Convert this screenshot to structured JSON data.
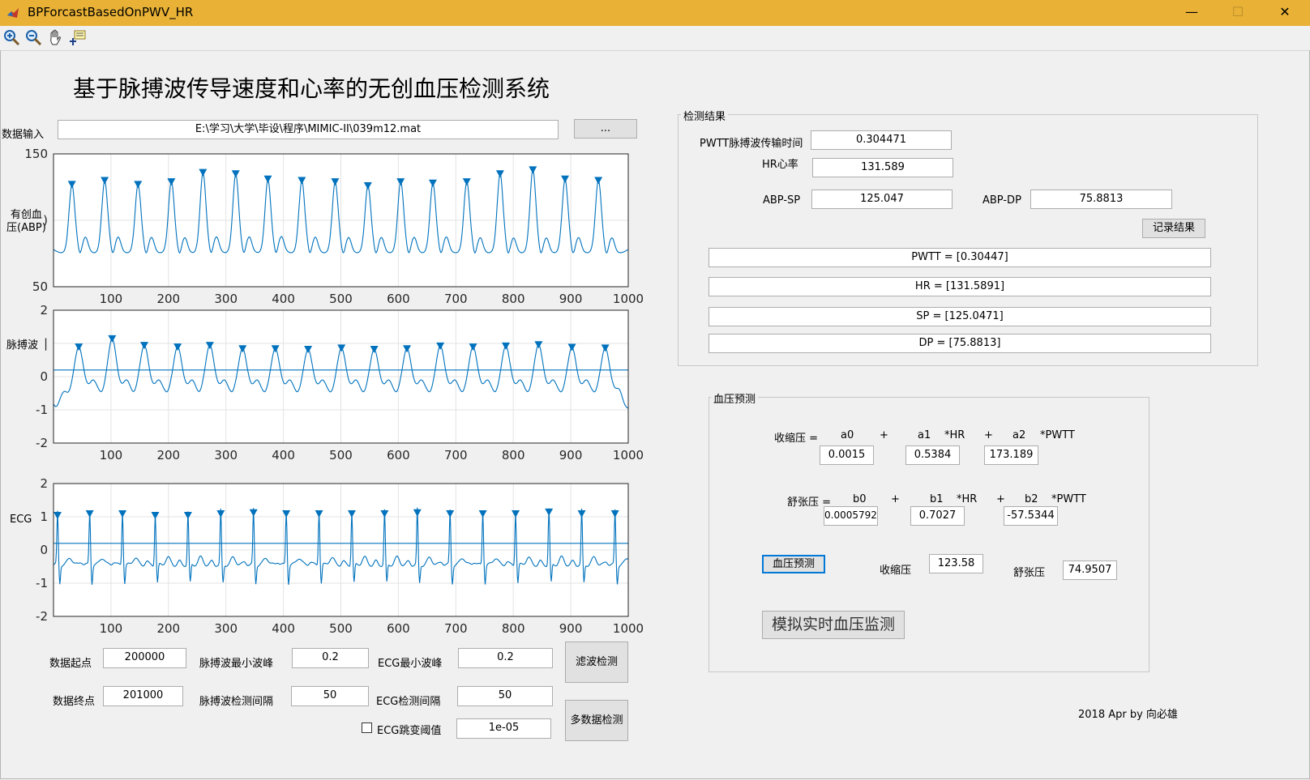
{
  "window": {
    "title": "BPForcastBasedOnPWV_HR",
    "minimize": "—",
    "maximize": "☐",
    "close": "✕"
  },
  "toolbar": {
    "icons": [
      "zoom-in-icon",
      "zoom-out-icon",
      "pan-icon",
      "data-cursor-icon"
    ]
  },
  "main_title": "基于脉搏波传导速度和心率的无创血压检测系统",
  "data_input": {
    "label": "数据输入",
    "path": "E:\\学习\\大学\\毕设\\程序\\MIMIC-II\\039m12.mat",
    "browse_label": "..."
  },
  "plots": {
    "abp": {
      "ylabel": "有创血压(ABP)",
      "ylabel_l1": "有创血",
      "ylabel_l2": "压(ABP)"
    },
    "ppg": {
      "ylabel": "脉搏波"
    },
    "ecg": {
      "ylabel": "ECG"
    }
  },
  "chart_data": [
    {
      "type": "line",
      "name": "abp",
      "xlim": [
        0,
        1000
      ],
      "ylim": [
        50,
        150
      ],
      "xticks": [
        100,
        200,
        300,
        400,
        500,
        600,
        700,
        800,
        900,
        1000
      ],
      "yticks": [
        {
          "v": 150,
          "t": "150"
        },
        {
          "v": 100,
          "t": ")"
        },
        {
          "v": 50,
          "t": "50"
        }
      ],
      "grid": true,
      "color": "#0072bd",
      "base": 78,
      "spike": 42,
      "peaks_x": [
        32,
        89,
        147,
        205,
        260,
        317,
        373,
        432,
        490,
        547,
        604,
        660,
        719,
        777,
        834,
        890,
        948
      ],
      "peaks_y": [
        126,
        129,
        126,
        128,
        135,
        134,
        130,
        129,
        128,
        125,
        128,
        127,
        128,
        134,
        137,
        130,
        129
      ],
      "markers": "down-triangle"
    },
    {
      "type": "line",
      "name": "ppg",
      "xlim": [
        0,
        1000
      ],
      "ylim": [
        -2,
        2
      ],
      "xticks": [
        100,
        200,
        300,
        400,
        500,
        600,
        700,
        800,
        900,
        1000
      ],
      "yticks": [
        {
          "v": 2,
          "t": "2"
        },
        {
          "v": 1,
          "t": "|"
        },
        {
          "v": 0,
          "t": "0"
        },
        {
          "v": -1,
          "t": "-1"
        },
        {
          "v": -2,
          "t": "-2"
        }
      ],
      "threshold": 0.2,
      "grid": true,
      "color": "#0072bd",
      "peaks_x": [
        44,
        102,
        158,
        216,
        272,
        329,
        386,
        443,
        501,
        558,
        615,
        673,
        730,
        787,
        844,
        902,
        960
      ],
      "peaks_y": [
        0.85,
        1.1,
        0.9,
        0.85,
        0.9,
        0.8,
        0.8,
        0.78,
        0.82,
        0.78,
        0.8,
        0.88,
        0.85,
        0.88,
        0.92,
        0.84,
        0.82
      ],
      "markers": "down-triangle"
    },
    {
      "type": "line",
      "name": "ecg",
      "xlim": [
        0,
        1000
      ],
      "ylim": [
        -2,
        2
      ],
      "xticks": [
        100,
        200,
        300,
        400,
        500,
        600,
        700,
        800,
        900,
        1000
      ],
      "yticks": [
        {
          "v": 2,
          "t": "2"
        },
        {
          "v": 1,
          "t": "1"
        },
        {
          "v": 0,
          "t": "0"
        },
        {
          "v": -1,
          "t": "-1"
        },
        {
          "v": -2,
          "t": "-2"
        }
      ],
      "threshold": 0.2,
      "grid": true,
      "color": "#0072bd",
      "peaks_x": [
        7,
        63,
        120,
        177,
        234,
        291,
        348,
        405,
        462,
        519,
        576,
        633,
        690,
        747,
        804,
        862,
        919,
        977
      ],
      "peaks_y": [
        1.0,
        1.05,
        1.05,
        1.0,
        1.0,
        1.05,
        1.08,
        1.05,
        1.05,
        1.05,
        1.05,
        1.08,
        1.05,
        1.05,
        1.05,
        1.1,
        1.05,
        1.05
      ],
      "markers": "down-triangle"
    }
  ],
  "controls": {
    "start_label": "数据起点",
    "start_value": "200000",
    "end_label": "数据终点",
    "end_value": "201000",
    "ppg_min_peak_label": "脉搏波最小波峰",
    "ppg_min_peak_value": "0.2",
    "ppg_interval_label": "脉搏波检测间隔",
    "ppg_interval_value": "50",
    "ecg_min_peak_label": "ECG最小波峰",
    "ecg_min_peak_value": "0.2",
    "ecg_interval_label": "ECG检测间隔",
    "ecg_interval_value": "50",
    "ecg_jump_label": "ECG跳变阈值",
    "ecg_jump_value": "1e-05",
    "ecg_jump_checked": false,
    "filter_button": "滤波检测",
    "multi_button": "多数据检测"
  },
  "results": {
    "title": "检测结果",
    "pwtt_label": "PWTT脉搏波传输时间",
    "pwtt_value": "0.304471",
    "hr_label": "HR心率",
    "hr_value": "131.589",
    "sp_label": "ABP-SP",
    "sp_value": "125.047",
    "dp_label": "ABP-DP",
    "dp_value": "75.8813",
    "record_button": "记录结果",
    "pwtt_list": "PWTT = [0.30447]",
    "hr_list": "HR = [131.5891]",
    "sp_list": "SP = [125.0471]",
    "dp_list": "DP = [75.8813]"
  },
  "prediction": {
    "title": "血压预测",
    "sys_eq": "收缩压 =",
    "a0": "a0",
    "plus": "+",
    "a1": "a1",
    "hr_term": "*HR",
    "a2": "a2",
    "pwtt_term": "*PWTT",
    "a0_value": "0.0015",
    "a1_value": "0.5384",
    "a2_value": "173.189",
    "dia_eq": "舒张压 =",
    "b0": "b0",
    "b1": "b1",
    "b2": "b2",
    "b0_value": "0.00057926",
    "b1_value": "0.7027",
    "b2_value": "-57.5344",
    "predict_button": "血压预测",
    "sys_label": "收缩压",
    "sys_value": "123.58",
    "dia_label": "舒张压",
    "dia_value": "74.9507",
    "realtime_button": "模拟实时血压监测"
  },
  "footer": "2018 Apr by 向必雄"
}
